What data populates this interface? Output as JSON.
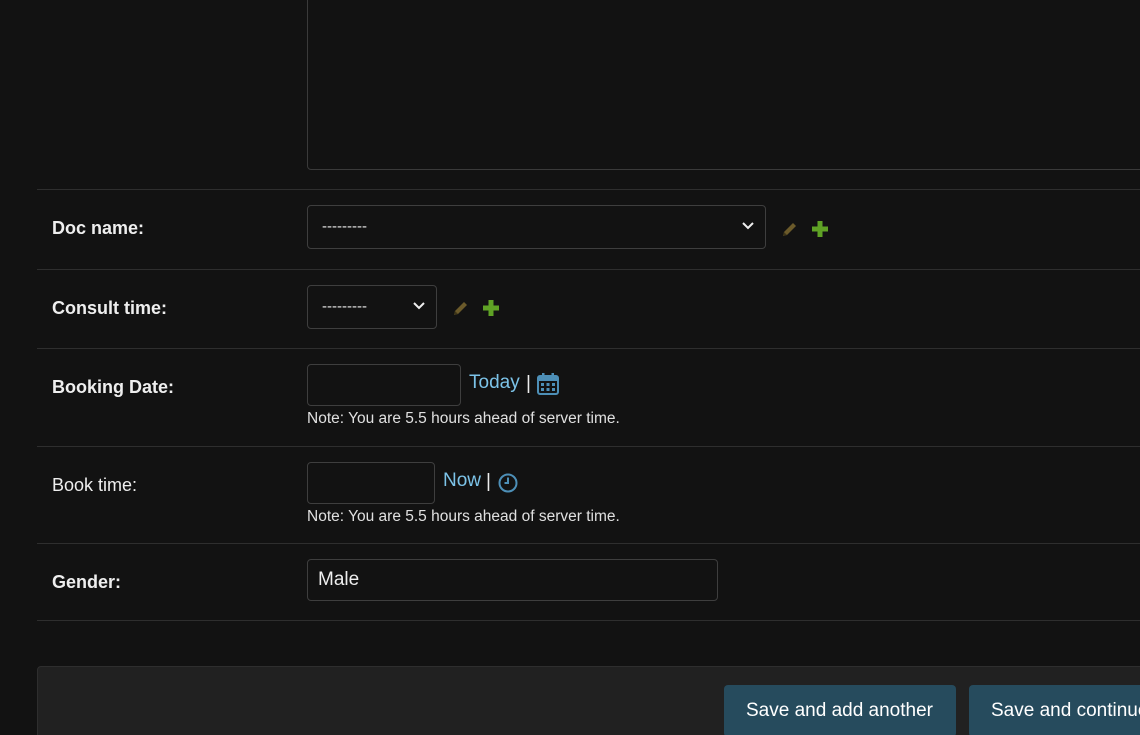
{
  "form": {
    "doc_name": {
      "label": "Doc name:",
      "selected": "---------"
    },
    "consult_time": {
      "label": "Consult time:",
      "selected": "---------"
    },
    "booking_date": {
      "label": "Booking Date:",
      "value": "",
      "shortcut": "Today",
      "separator": "|",
      "note": "Note: You are 5.5 hours ahead of server time."
    },
    "book_time": {
      "label": "Book time:",
      "value": "",
      "shortcut": "Now",
      "separator": "|",
      "note": "Note: You are 5.5 hours ahead of server time."
    },
    "gender": {
      "label": "Gender:",
      "value": "Male"
    }
  },
  "submit_row": {
    "save_add_another": "Save and add another",
    "save_continue": "Save and continue editing"
  },
  "icons": {
    "edit": "pencil-icon",
    "add": "plus-icon",
    "calendar": "calendar-icon",
    "clock": "clock-icon"
  },
  "colors": {
    "background": "#121212",
    "link": "#7cc3e8",
    "button": "#264b5d",
    "add_green": "#5fa225",
    "edit_disabled": "#6b5a2a"
  }
}
